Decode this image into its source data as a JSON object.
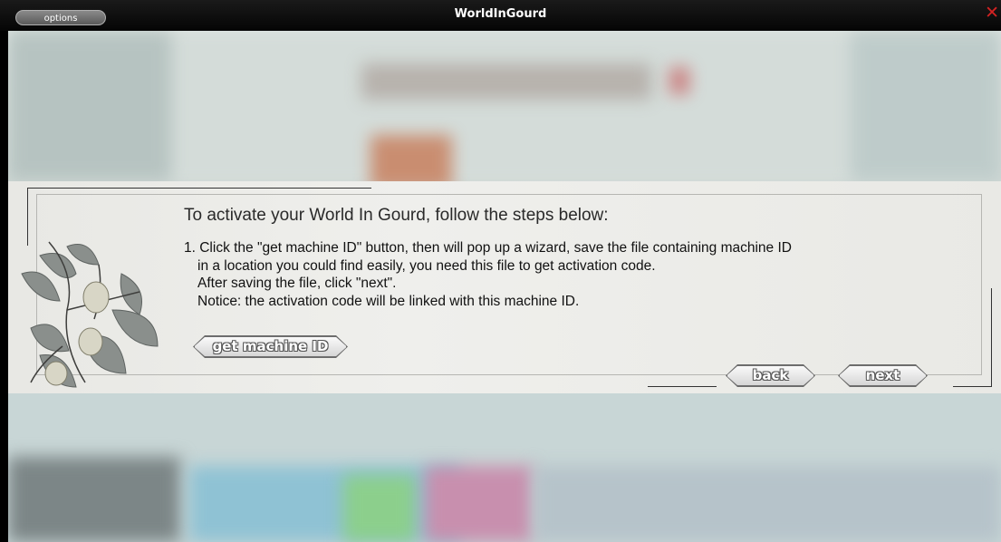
{
  "window": {
    "title": "WorldInGourd",
    "options_label": "options",
    "close_glyph": "✕"
  },
  "activation": {
    "heading": "To activate your World In Gourd, follow the steps below:",
    "step_lines": [
      "1. Click the \"get machine ID\" button, then will pop up a wizard, save the file containing machine ID",
      "in a location you could find easily, you need this file to get activation code.",
      "After saving the file, click \"next\".",
      "Notice: the activation code will be linked with this machine ID."
    ],
    "get_machine_id_label": "get machine ID",
    "back_label": "back",
    "next_label": "next"
  },
  "icons": [
    "close-icon",
    "gourd-vine-illustration"
  ],
  "colors": {
    "titlebar": "#0a0a0a",
    "close": "#d32222",
    "panel": "#ececE8"
  }
}
